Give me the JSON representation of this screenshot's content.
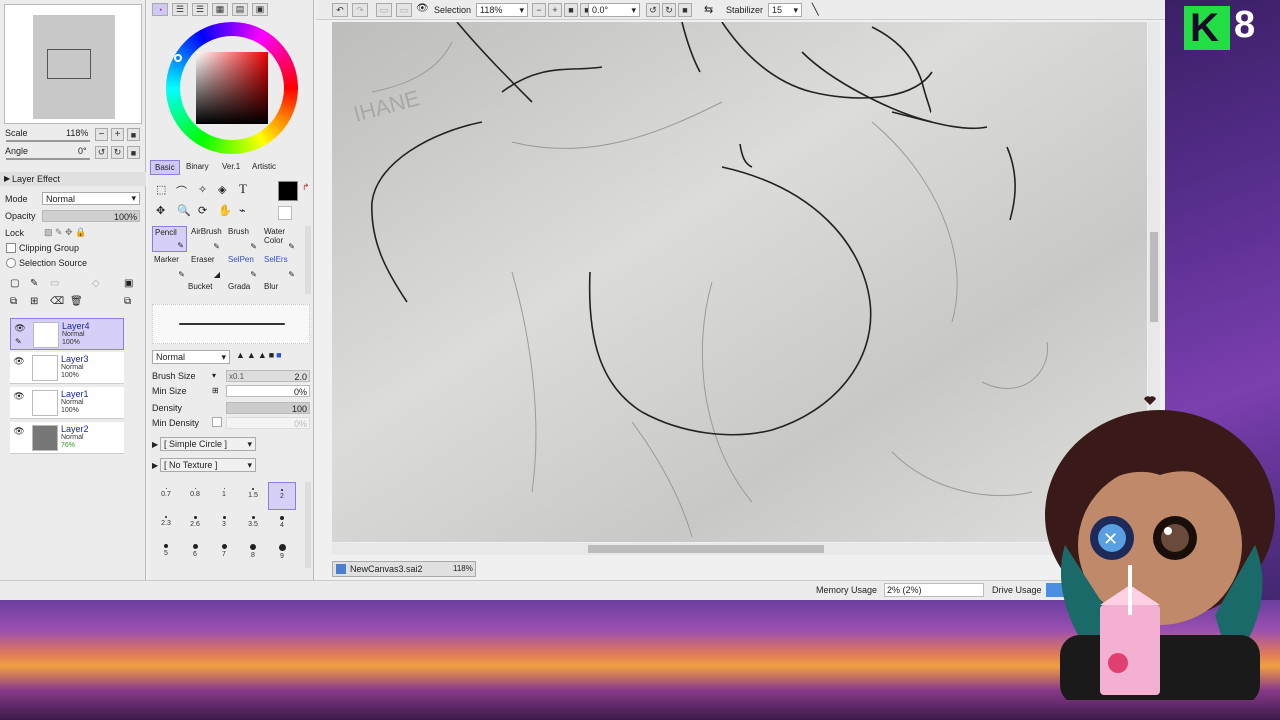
{
  "toolbar": {
    "selection_label": "Selection",
    "zoom": "118%",
    "rotation": "0.0°",
    "stabilizer_label": "Stabilizer",
    "stabilizer_value": "15"
  },
  "navigator": {
    "scale_label": "Scale",
    "scale_value": "118%",
    "angle_label": "Angle",
    "angle_value": "0°"
  },
  "layer_panel": {
    "effect_label": "Layer Effect",
    "mode_label": "Mode",
    "mode_value": "Normal",
    "opacity_label": "Opacity",
    "opacity_value": "100%",
    "lock_label": "Lock",
    "clipping_label": "Clipping Group",
    "selection_source_label": "Selection Source",
    "layers": [
      {
        "name": "Layer4",
        "mode": "Normal",
        "opacity": "100%"
      },
      {
        "name": "Layer3",
        "mode": "Normal",
        "opacity": "100%"
      },
      {
        "name": "Layer1",
        "mode": "Normal",
        "opacity": "100%"
      },
      {
        "name": "Layer2",
        "mode": "Normal",
        "opacity": "76%"
      }
    ]
  },
  "color_tabs": [
    "Basic",
    "Binary",
    "Ver.1",
    "Artistic"
  ],
  "tools": {
    "pencil": "Pencil",
    "airbrush": "AirBrush",
    "brush": "Brush",
    "water": "Water Color",
    "marker": "Marker",
    "eraser": "Eraser",
    "selpen": "SelPen",
    "selers": "SelErs",
    "bucket": "Bucket",
    "grada": "Grada",
    "blur": "Blur"
  },
  "brush": {
    "blend_mode": "Normal",
    "size_label": "Brush Size",
    "size_multiplier": "x0.1",
    "size_value": "2.0",
    "min_size_label": "Min Size",
    "min_size_value": "0%",
    "density_label": "Density",
    "density_value": "100",
    "min_density_label": "Min Density",
    "min_density_value": "0%",
    "shape": "[ Simple Circle ]",
    "texture": "[ No Texture ]",
    "sizes": [
      "0.7",
      "0.8",
      "1",
      "1.5",
      "2",
      "2.3",
      "2.6",
      "3",
      "3.5",
      "4",
      "5",
      "6",
      "7",
      "8",
      "9"
    ]
  },
  "document": {
    "tab_name": "NewCanvas3.sai2",
    "tab_zoom": "118%"
  },
  "status": {
    "memory_label": "Memory Usage",
    "memory_value": "2% (2%)",
    "drive_label": "Drive Usage"
  },
  "overlay": {
    "badge_letter": "K",
    "badge_number": "8"
  },
  "colors": {
    "accent": "#8a7fe0",
    "primary_color": "#000000",
    "badge_green": "#22dd44"
  }
}
